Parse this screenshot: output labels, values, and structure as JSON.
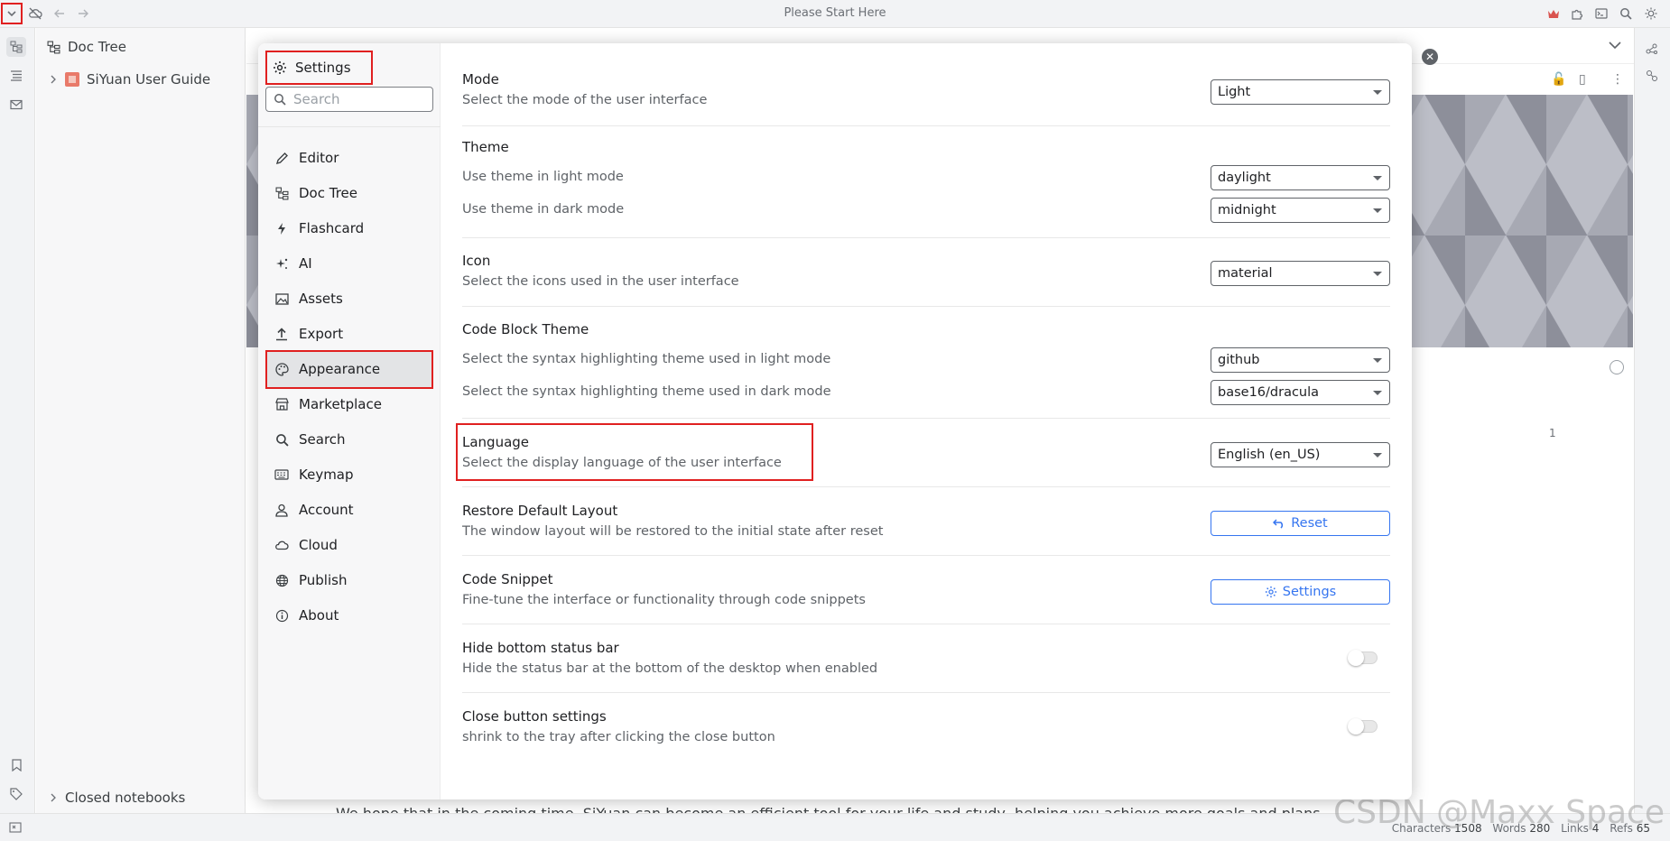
{
  "window": {
    "title": "Please Start Here"
  },
  "doc_tree": {
    "header": "Doc Tree",
    "notebook": "SiYuan User Guide",
    "closed_notebooks": "Closed notebooks"
  },
  "editor": {
    "bottom_text": "We hope that in the coming time, SiYuan can become an efficient tool for your life and study, helping you achieve more goals and plans",
    "badge_count": "1"
  },
  "status_bar": {
    "characters_label": "Characters",
    "characters": "1508",
    "words_label": "Words",
    "words": "280",
    "links_label": "Links",
    "links": "4",
    "refs_label": "Refs",
    "refs": "65"
  },
  "watermark": "CSDN @Maxx Space",
  "settings": {
    "title": "Settings",
    "search_placeholder": "Search",
    "nav": [
      {
        "label": "Editor",
        "icon": "pencil-icon"
      },
      {
        "label": "Doc Tree",
        "icon": "doc-tree-icon"
      },
      {
        "label": "Flashcard",
        "icon": "flashcard-icon"
      },
      {
        "label": "AI",
        "icon": "sparkle-icon"
      },
      {
        "label": "Assets",
        "icon": "image-icon"
      },
      {
        "label": "Export",
        "icon": "export-icon"
      },
      {
        "label": "Appearance",
        "icon": "palette-icon",
        "active": true
      },
      {
        "label": "Marketplace",
        "icon": "store-icon"
      },
      {
        "label": "Search",
        "icon": "search-icon"
      },
      {
        "label": "Keymap",
        "icon": "keyboard-icon"
      },
      {
        "label": "Account",
        "icon": "user-icon"
      },
      {
        "label": "Cloud",
        "icon": "cloud-icon"
      },
      {
        "label": "Publish",
        "icon": "globe-icon"
      },
      {
        "label": "About",
        "icon": "info-icon"
      }
    ],
    "mode": {
      "title": "Mode",
      "desc": "Select the mode of the user interface",
      "value": "Light"
    },
    "theme": {
      "title": "Theme",
      "light_desc": "Use theme in light mode",
      "light_value": "daylight",
      "dark_desc": "Use theme in dark mode",
      "dark_value": "midnight"
    },
    "icon": {
      "title": "Icon",
      "desc": "Select the icons used in the user interface",
      "value": "material"
    },
    "code_theme": {
      "title": "Code Block Theme",
      "light_desc": "Select the syntax highlighting theme used in light mode",
      "light_value": "github",
      "dark_desc": "Select the syntax highlighting theme used in dark mode",
      "dark_value": "base16/dracula"
    },
    "language": {
      "title": "Language",
      "desc": "Select the display language of the user interface",
      "value": "English (en_US)"
    },
    "restore_layout": {
      "title": "Restore Default Layout",
      "desc": "The window layout will be restored to the initial state after reset",
      "button": "Reset"
    },
    "code_snippet": {
      "title": "Code Snippet",
      "desc": "Fine-tune the interface or functionality through code snippets",
      "button": "Settings"
    },
    "hide_status": {
      "title": "Hide bottom status bar",
      "desc": "Hide the status bar at the bottom of the desktop when enabled"
    },
    "close_button": {
      "title": "Close button settings",
      "desc": "shrink to the tray after clicking the close button"
    }
  },
  "colors": {
    "accent": "#3575f0",
    "highlight": "#e02020"
  }
}
